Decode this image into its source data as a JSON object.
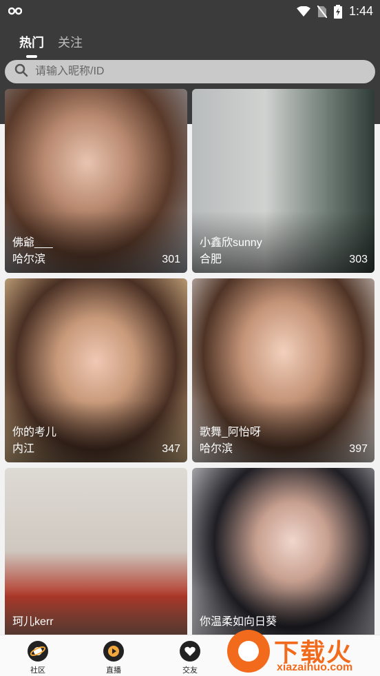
{
  "status_bar": {
    "time": "1:44",
    "icons": [
      "infinity-icon",
      "wifi-icon",
      "no-sim-icon",
      "battery-charging-icon"
    ]
  },
  "tabs": [
    {
      "label": "热门",
      "active": true
    },
    {
      "label": "关注",
      "active": false
    }
  ],
  "search": {
    "placeholder": "请输入昵称/ID",
    "icon": "search-icon"
  },
  "cards": [
    {
      "name": "佛爺___",
      "city": "哈尔滨",
      "count": "301"
    },
    {
      "name": "小鑫欣sunny",
      "city": "合肥",
      "count": "303"
    },
    {
      "name": "你的考儿",
      "city": "内江",
      "count": "347"
    },
    {
      "name": "歌舞_阿怡呀",
      "city": "哈尔滨",
      "count": "397"
    },
    {
      "name": "珂儿kerr",
      "city": "",
      "count": ""
    },
    {
      "name": "你温柔如向日葵",
      "city": "",
      "count": ""
    }
  ],
  "bottom_nav": [
    {
      "label": "社区",
      "icon": "planet-icon"
    },
    {
      "label": "直播",
      "icon": "play-icon"
    },
    {
      "label": "交友",
      "icon": "heart-icon"
    }
  ],
  "watermark": {
    "text": "下载火",
    "url_text": "xiazaihuo.com"
  },
  "colors": {
    "header_bg": "#3b3b3b",
    "watermark_orange": "#f26a1b"
  }
}
